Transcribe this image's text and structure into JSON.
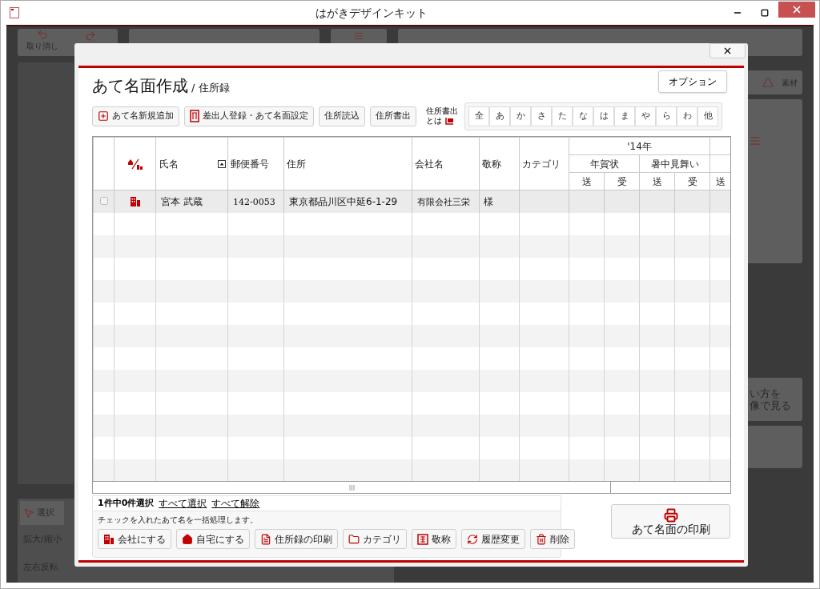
{
  "window": {
    "title": "はがきデザインキット"
  },
  "background": {
    "undo_label": "取り消し",
    "material_label": "素材",
    "video_link": [
      "い方を",
      "像で見る"
    ],
    "tool_tab": "選択",
    "zoom_label": "拡大/縮小",
    "flip_label": "左右反転"
  },
  "dialog": {
    "title": "あて名面作成",
    "subtitle": "/ 住所録",
    "option_button": "オプション",
    "toolbar": [
      {
        "label": "あて名新規追加",
        "kind": "add"
      },
      {
        "label": "差出人登録・あて名面設定",
        "kind": "sender"
      },
      {
        "label": "住所読込",
        "kind": "plain"
      },
      {
        "label": "住所書出",
        "kind": "plain"
      }
    ],
    "export_help": [
      "住所書出",
      "とは"
    ],
    "kana_filter": [
      "全",
      "あ",
      "か",
      "さ",
      "た",
      "な",
      "は",
      "ま",
      "や",
      "ら",
      "わ",
      "他"
    ],
    "table": {
      "columns": [
        "氏名",
        "郵便番号",
        "住所",
        "会社名",
        "敬称",
        "カテゴリ"
      ],
      "year_group": "'14年",
      "events": [
        "年賀状",
        "暑中見舞い"
      ],
      "sub_columns": [
        "送",
        "受",
        "送",
        "受",
        "送"
      ],
      "rows": [
        {
          "checked": false,
          "kind": "company",
          "name": "宮本 武蔵",
          "postal_code": "142-0053",
          "address": "東京都品川区中延6-1-29",
          "company": "有限会社三栄",
          "honorific": "様"
        }
      ]
    },
    "selection": {
      "count": "1件中0件選択",
      "select_all": "すべて選択",
      "clear_all": "すべて解除",
      "hint": "チェックを入れたあて名を一括処理します。",
      "actions": [
        {
          "label": "会社にする",
          "kind": "company"
        },
        {
          "label": "自宅にする",
          "kind": "home"
        },
        {
          "label": "住所録の印刷",
          "kind": "list"
        },
        {
          "label": "カテゴリ",
          "kind": "folder"
        },
        {
          "label": "敬称",
          "kind": "honorific"
        },
        {
          "label": "履歴変更",
          "kind": "history"
        },
        {
          "label": "削除",
          "kind": "delete"
        }
      ]
    },
    "print_button": "あて名面の印刷"
  }
}
